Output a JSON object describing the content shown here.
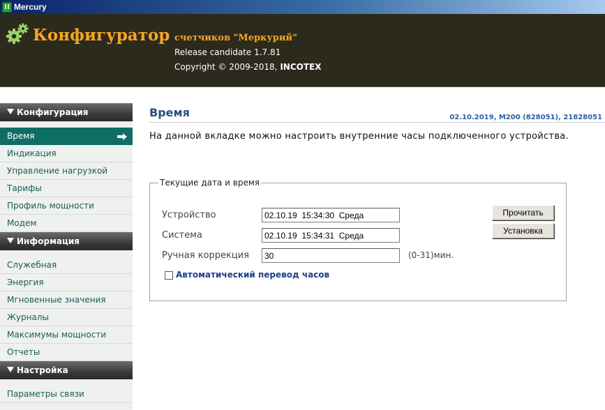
{
  "window": {
    "title": "Mercury"
  },
  "header": {
    "brand": "Конфигуратор",
    "subtitle": "счетчиков \"Меркурий\"",
    "release": "Release candidate 1.7.81",
    "copyright_prefix": "Copyright © 2009-2018, ",
    "copyright_company": "INCOTEX"
  },
  "sidebar": {
    "sections": [
      {
        "title": "Конфигурация",
        "items": [
          "Время",
          "Индикация",
          "Управление нагрузкой",
          "Тарифы",
          "Профиль мощности",
          "Модем"
        ]
      },
      {
        "title": "Информация",
        "items": [
          "Служебная",
          "Энергия",
          "Мгновенные значения",
          "Журналы",
          "Максимумы мощности",
          "Отчеты"
        ]
      },
      {
        "title": "Настройка",
        "items": [
          "Параметры связи"
        ]
      }
    ],
    "active_item": "Время"
  },
  "main": {
    "title": "Время",
    "device_info": "02.10.2019, M200 (828051), 21828051",
    "description": "На данной вкладке можно настроить внутренние часы подключенного устройства.",
    "group": {
      "legend": "Текущие дата и время",
      "device_label": "Устройство",
      "device_value": "02.10.19  15:34:30  Среда",
      "system_label": "Система",
      "system_value": "02.10.19  15:34:31  Среда",
      "correction_label": "Ручная коррекция",
      "correction_value": "30",
      "correction_unit": "(0-31)мин.",
      "read_button": "Прочитать",
      "set_button": "Установка",
      "auto_dst_label": "Автоматический перевод часов",
      "auto_dst_checked": false
    }
  },
  "colors": {
    "header_bg": "#2c2a1c",
    "brand": "#f5a623",
    "sidebar_active": "#0f6e64",
    "title_blue": "#2b4f7e"
  }
}
